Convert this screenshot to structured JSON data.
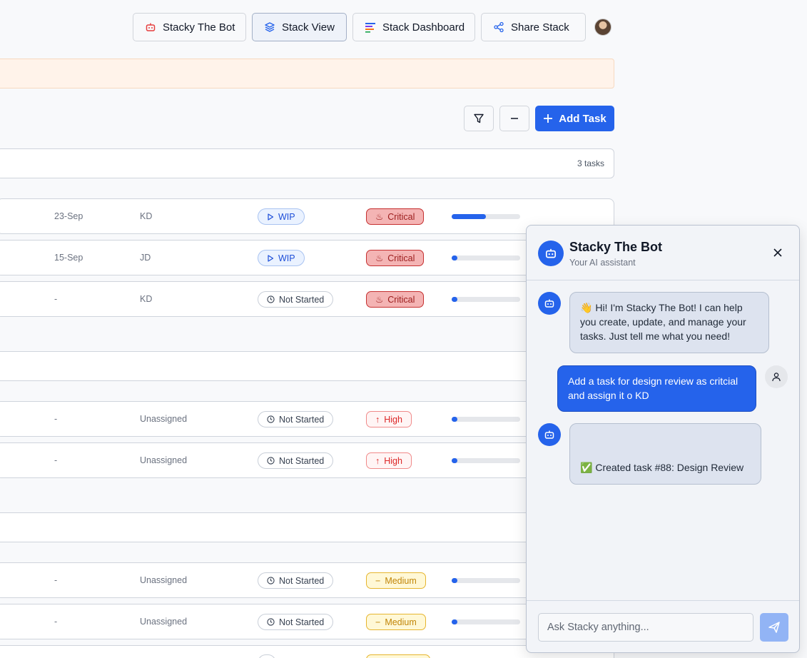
{
  "header": {
    "buttons": [
      {
        "label": "Stacky The Bot",
        "icon": "bot-icon"
      },
      {
        "label": "Stack View",
        "icon": "layers-icon"
      },
      {
        "label": "Stack Dashboard",
        "icon": "bars-icon"
      },
      {
        "label": "Share Stack",
        "icon": "share-icon"
      }
    ]
  },
  "toolbar": {
    "add_task_label": "Add Task"
  },
  "list": {
    "task_count": "3 tasks"
  },
  "rows": [
    {
      "date": "23-Sep",
      "assignee": "KD",
      "status": "WIP",
      "priority": "Critical",
      "progress": 0.5
    },
    {
      "date": "15-Sep",
      "assignee": "JD",
      "status": "WIP",
      "priority": "Critical",
      "progress": 0.05
    },
    {
      "date": "-",
      "assignee": "KD",
      "status": "Not Started",
      "priority": "Critical",
      "progress": 0.05
    },
    {
      "date": "-",
      "assignee": "Unassigned",
      "status": "Not Started",
      "priority": "High",
      "progress": 0.05
    },
    {
      "date": "-",
      "assignee": "Unassigned",
      "status": "Not Started",
      "priority": "High",
      "progress": 0.05
    },
    {
      "date": "-",
      "assignee": "Unassigned",
      "status": "Not Started",
      "priority": "Medium",
      "progress": 0.05
    },
    {
      "date": "-",
      "assignee": "Unassigned",
      "status": "Not Started",
      "priority": "Medium",
      "progress": 0.05
    }
  ],
  "chat": {
    "title": "Stacky The Bot",
    "subtitle": "Your AI assistant",
    "messages": [
      {
        "role": "bot",
        "emoji": "👋",
        "text": "Hi! I'm Stacky The Bot! I can help you create, update, and manage your tasks. Just tell me what you need!"
      },
      {
        "role": "user",
        "text": "Add a task for design review as critcial and assign it o KD"
      },
      {
        "role": "bot",
        "emoji": "✅",
        "text": "Created task #88: Design Review"
      }
    ],
    "input_placeholder": "Ask Stacky anything..."
  },
  "colors": {
    "accent": "#2563eb",
    "critical": "#c53030",
    "high": "#dc2626",
    "medium": "#c18507"
  }
}
